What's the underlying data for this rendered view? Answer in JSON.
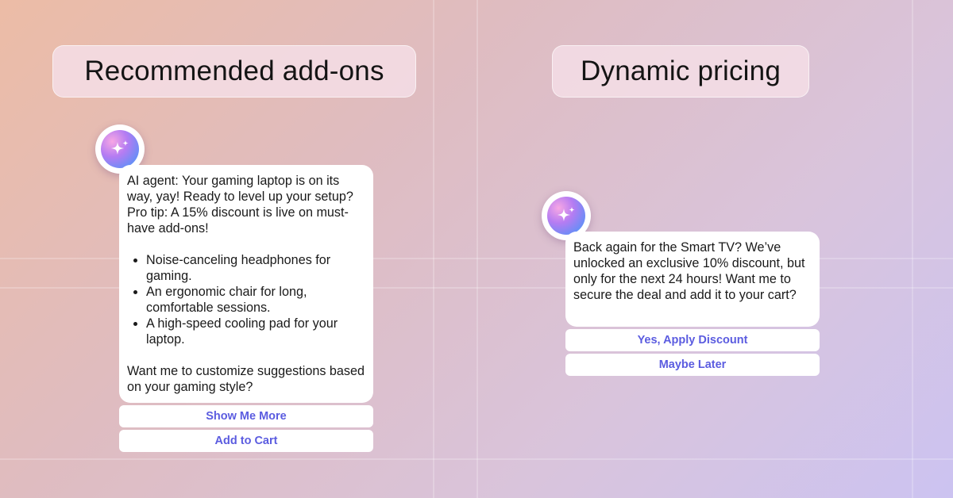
{
  "left_panel": {
    "heading": "Recommended add-ons",
    "message": {
      "intro": "AI agent: Your gaming laptop is on its way, yay! Ready to level up your setup? Pro tip: A 15% discount is live on must-have add-ons!",
      "items": [
        "Noise-canceling headphones for gaming.",
        "An ergonomic chair for long, comfortable sessions.",
        "A high-speed cooling pad for your laptop."
      ],
      "outro": "Want me to customize suggestions based on your gaming style?"
    },
    "buttons": [
      "Show Me More",
      "Add to Cart"
    ]
  },
  "right_panel": {
    "heading": "Dynamic pricing",
    "message": "Back again for the Smart TV? We’ve unlocked an exclusive 10% discount, but only for the next 24 hours! Want me to secure the deal and add it to your cart?",
    "buttons": [
      "Yes, Apply Discount",
      "Maybe Later"
    ]
  },
  "icons": {
    "avatar": "sparkle-icon"
  },
  "colors": {
    "button_text": "#5b5ce0",
    "background_start": "#ecbca6",
    "background_end": "#ccc3f1"
  }
}
